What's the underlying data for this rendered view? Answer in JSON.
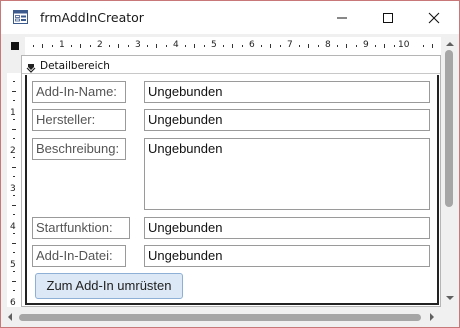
{
  "window": {
    "title": "frmAddInCreator",
    "icon": "form-icon",
    "controls": [
      "minimize-icon",
      "maximize-icon",
      "close-icon"
    ]
  },
  "rulers": {
    "horizontal_numbers": [
      "1",
      "2",
      "3",
      "4",
      "5",
      "6",
      "7",
      "8",
      "9",
      "10"
    ],
    "vertical_numbers": [
      "1",
      "2",
      "3",
      "4",
      "5",
      "6"
    ]
  },
  "section": {
    "label": "Detailbereich"
  },
  "fields": [
    {
      "label": "Add-In-Name:",
      "value": "Ungebunden"
    },
    {
      "label": "Hersteller:",
      "value": "Ungebunden"
    },
    {
      "label": "Beschreibung:",
      "value": "Ungebunden"
    },
    {
      "label": "Startfunktion:",
      "value": "Ungebunden"
    },
    {
      "label": "Add-In-Datei:",
      "value": "Ungebunden"
    }
  ],
  "button": {
    "label": "Zum Add-In umrüsten"
  },
  "colors": {
    "button_bg": "#dce8f5",
    "button_border": "#8fb0d6",
    "window_border": "#c87878",
    "scroll_thumb": "#a6a6a6"
  }
}
